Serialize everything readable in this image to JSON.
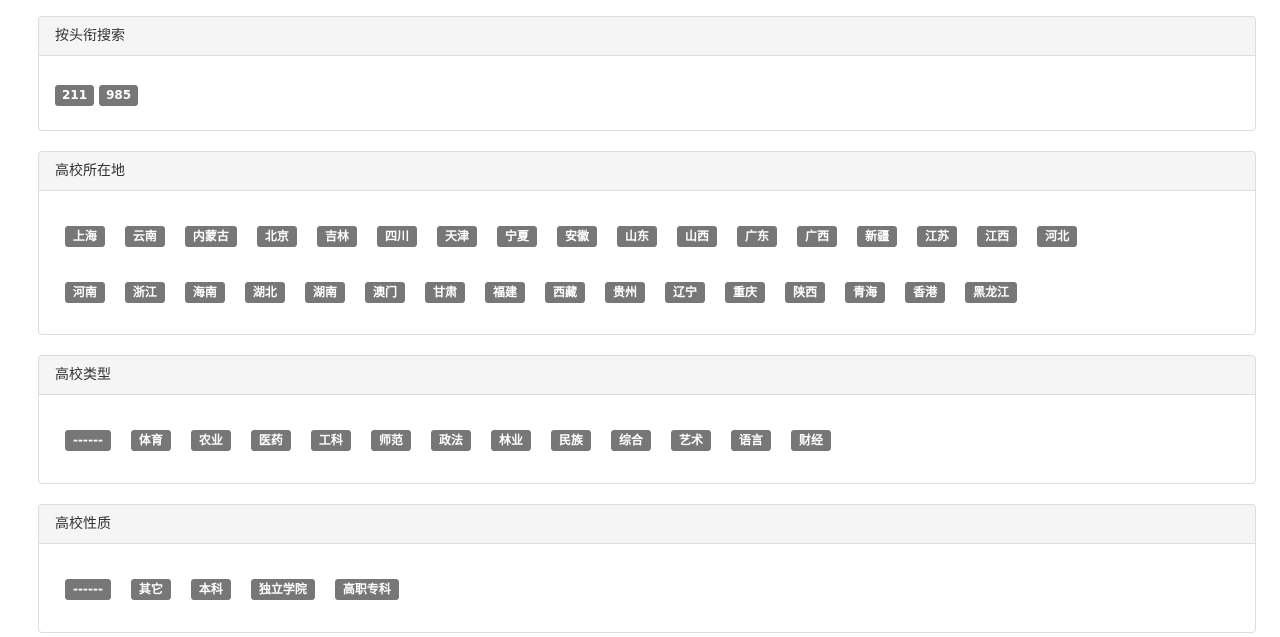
{
  "panels": {
    "title_search": {
      "heading": "按头衔搜索",
      "tags": [
        "211",
        "985"
      ]
    },
    "location": {
      "heading": "高校所在地",
      "row_a": [
        "上海",
        "云南",
        "内蒙古",
        "北京",
        "吉林",
        "四川",
        "天津",
        "宁夏",
        "安徽",
        "山东",
        "山西",
        "广东",
        "广西",
        "新疆",
        "江苏",
        "江西",
        "河北"
      ],
      "row_b": [
        "河南",
        "浙江",
        "海南",
        "湖北",
        "湖南",
        "澳门",
        "甘肃",
        "福建",
        "西藏",
        "贵州",
        "辽宁",
        "重庆",
        "陕西",
        "青海",
        "香港",
        "黑龙江"
      ]
    },
    "type": {
      "heading": "高校类型",
      "tags": [
        "------",
        "体育",
        "农业",
        "医药",
        "工科",
        "师范",
        "政法",
        "林业",
        "民族",
        "综合",
        "艺术",
        "语言",
        "财经"
      ]
    },
    "nature": {
      "heading": "高校性质",
      "tags": [
        "------",
        "其它",
        "本科",
        "独立学院",
        "高职专科"
      ]
    }
  },
  "colors": {
    "tag_bg": "#777777",
    "tag_text": "#ffffff",
    "heading_bg": "#f5f5f5",
    "border": "#dddddd"
  }
}
